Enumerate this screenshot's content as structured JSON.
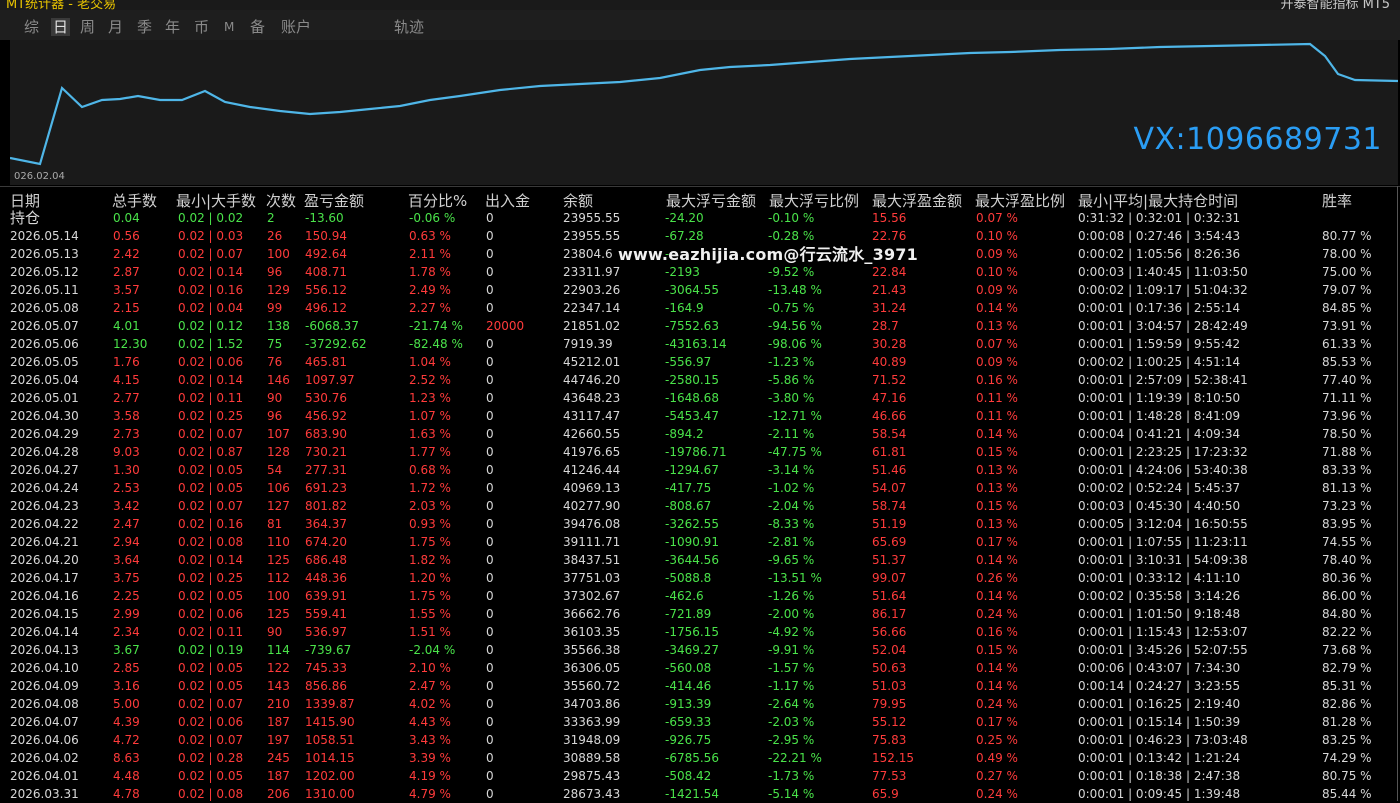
{
  "window": {
    "title_left": "MT统计器 - 老交易",
    "title_right": "开泰智能指标 MT5"
  },
  "tabs": [
    {
      "label": "综",
      "active": false
    },
    {
      "label": "日",
      "active": true
    },
    {
      "label": "周",
      "active": false
    },
    {
      "label": "月",
      "active": false
    },
    {
      "label": "季",
      "active": false
    },
    {
      "label": "年",
      "active": false
    },
    {
      "label": "币",
      "active": false
    },
    {
      "label": "M",
      "active": false
    },
    {
      "label": "备",
      "active": false
    },
    {
      "label": "账户",
      "active": false
    },
    {
      "label": "轨迹",
      "active": false
    }
  ],
  "chart": {
    "start_label": "026.02.04",
    "line_color": "#4fb6e8",
    "watermark": "VX:1096689731"
  },
  "watermark_site": "www.eazhijia.com@行云流水_3971",
  "colors": {
    "up": "#ff3b3b",
    "down": "#4ae34a",
    "neutral": "#d8d8d8",
    "vx": "#2a9df4"
  },
  "table": {
    "headers": {
      "date": "日期",
      "lots": "总手数",
      "range": "最小|大手数",
      "trades": "次数",
      "pnl": "盈亏金额",
      "pct": "百分比%",
      "io": "出入金",
      "bal": "余额",
      "mfl": "最大浮亏金额",
      "mflp": "最大浮亏比例",
      "mfp": "最大浮盈金额",
      "mfpp": "最大浮盈比例",
      "hold": "最小|平均|最大持仓时间",
      "win": "胜率"
    },
    "holding": {
      "label": "持仓",
      "lots": "0.04",
      "range": "0.02 | 0.02",
      "trades": "2",
      "pnl": "-13.60",
      "pct": "-0.06 %",
      "io": "0",
      "bal": "23955.55",
      "mfl": "-24.20",
      "mflp": "-0.10 %",
      "mfp": "15.56",
      "mfpp": "0.07 %",
      "hold": "0:31:32 | 0:32:01 | 0:32:31",
      "win": ""
    },
    "rows": [
      {
        "date": "2026.05.14",
        "lots": "0.56",
        "range": "0.02 | 0.03",
        "trades": "26",
        "pnl": "150.94",
        "pct": "0.63 %",
        "io": "0",
        "bal": "23955.55",
        "mfl": "-67.28",
        "mflp": "-0.28 %",
        "mfp": "22.76",
        "mfpp": "0.10 %",
        "hold": "0:00:08 | 0:27:46 | 3:54:43",
        "win": "80.77 %",
        "up": true
      },
      {
        "date": "2026.05.13",
        "lots": "2.42",
        "range": "0.02 | 0.07",
        "trades": "100",
        "pnl": "492.64",
        "pct": "2.11 %",
        "io": "0",
        "bal": "23804.6",
        "mfl": "-",
        "mflp": "",
        "mfp": "",
        "mfpp": "0.09 %",
        "hold": "0:00:02 | 1:05:56 | 8:26:36",
        "win": "78.00 %",
        "up": true
      },
      {
        "date": "2026.05.12",
        "lots": "2.87",
        "range": "0.02 | 0.14",
        "trades": "96",
        "pnl": "408.71",
        "pct": "1.78 %",
        "io": "0",
        "bal": "23311.97",
        "mfl": "-2193",
        "mflp": "-9.52 %",
        "mfp": "22.84",
        "mfpp": "0.10 %",
        "hold": "0:00:03 | 1:40:45 | 11:03:50",
        "win": "75.00 %",
        "up": true
      },
      {
        "date": "2026.05.11",
        "lots": "3.57",
        "range": "0.02 | 0.16",
        "trades": "129",
        "pnl": "556.12",
        "pct": "2.49 %",
        "io": "0",
        "bal": "22903.26",
        "mfl": "-3064.55",
        "mflp": "-13.48 %",
        "mfp": "21.43",
        "mfpp": "0.09 %",
        "hold": "0:00:02 | 1:09:17 | 51:04:32",
        "win": "79.07 %",
        "up": true
      },
      {
        "date": "2026.05.08",
        "lots": "2.15",
        "range": "0.02 | 0.04",
        "trades": "99",
        "pnl": "496.12",
        "pct": "2.27 %",
        "io": "0",
        "bal": "22347.14",
        "mfl": "-164.9",
        "mflp": "-0.75 %",
        "mfp": "31.24",
        "mfpp": "0.14 %",
        "hold": "0:00:01 | 0:17:36 | 2:55:14",
        "win": "84.85 %",
        "up": true
      },
      {
        "date": "2026.05.07",
        "lots": "4.01",
        "range": "0.02 | 0.12",
        "trades": "138",
        "pnl": "-6068.37",
        "pct": "-21.74 %",
        "io": "20000",
        "bal": "21851.02",
        "mfl": "-7552.63",
        "mflp": "-94.56 %",
        "mfp": "28.7",
        "mfpp": "0.13 %",
        "hold": "0:00:01 | 3:04:57 | 28:42:49",
        "win": "73.91 %",
        "up": false
      },
      {
        "date": "2026.05.06",
        "lots": "12.30",
        "range": "0.02 | 1.52",
        "trades": "75",
        "pnl": "-37292.62",
        "pct": "-82.48 %",
        "io": "0",
        "bal": "7919.39",
        "mfl": "-43163.14",
        "mflp": "-98.06 %",
        "mfp": "30.28",
        "mfpp": "0.07 %",
        "hold": "0:00:01 | 1:59:59 | 9:55:42",
        "win": "61.33 %",
        "up": false
      },
      {
        "date": "2026.05.05",
        "lots": "1.76",
        "range": "0.02 | 0.06",
        "trades": "76",
        "pnl": "465.81",
        "pct": "1.04 %",
        "io": "0",
        "bal": "45212.01",
        "mfl": "-556.97",
        "mflp": "-1.23 %",
        "mfp": "40.89",
        "mfpp": "0.09 %",
        "hold": "0:00:02 | 1:00:25 | 4:51:14",
        "win": "85.53 %",
        "up": true
      },
      {
        "date": "2026.05.04",
        "lots": "4.15",
        "range": "0.02 | 0.14",
        "trades": "146",
        "pnl": "1097.97",
        "pct": "2.52 %",
        "io": "0",
        "bal": "44746.20",
        "mfl": "-2580.15",
        "mflp": "-5.86 %",
        "mfp": "71.52",
        "mfpp": "0.16 %",
        "hold": "0:00:01 | 2:57:09 | 52:38:41",
        "win": "77.40 %",
        "up": true
      },
      {
        "date": "2026.05.01",
        "lots": "2.77",
        "range": "0.02 | 0.11",
        "trades": "90",
        "pnl": "530.76",
        "pct": "1.23 %",
        "io": "0",
        "bal": "43648.23",
        "mfl": "-1648.68",
        "mflp": "-3.80 %",
        "mfp": "47.16",
        "mfpp": "0.11 %",
        "hold": "0:00:01 | 1:19:39 | 8:10:50",
        "win": "71.11 %",
        "up": true
      },
      {
        "date": "2026.04.30",
        "lots": "3.58",
        "range": "0.02 | 0.25",
        "trades": "96",
        "pnl": "456.92",
        "pct": "1.07 %",
        "io": "0",
        "bal": "43117.47",
        "mfl": "-5453.47",
        "mflp": "-12.71 %",
        "mfp": "46.66",
        "mfpp": "0.11 %",
        "hold": "0:00:01 | 1:48:28 | 8:41:09",
        "win": "73.96 %",
        "up": true
      },
      {
        "date": "2026.04.29",
        "lots": "2.73",
        "range": "0.02 | 0.07",
        "trades": "107",
        "pnl": "683.90",
        "pct": "1.63 %",
        "io": "0",
        "bal": "42660.55",
        "mfl": "-894.2",
        "mflp": "-2.11 %",
        "mfp": "58.54",
        "mfpp": "0.14 %",
        "hold": "0:00:04 | 0:41:21 | 4:09:34",
        "win": "78.50 %",
        "up": true
      },
      {
        "date": "2026.04.28",
        "lots": "9.03",
        "range": "0.02 | 0.87",
        "trades": "128",
        "pnl": "730.21",
        "pct": "1.77 %",
        "io": "0",
        "bal": "41976.65",
        "mfl": "-19786.71",
        "mflp": "-47.75 %",
        "mfp": "61.81",
        "mfpp": "0.15 %",
        "hold": "0:00:01 | 2:23:25 | 17:23:32",
        "win": "71.88 %",
        "up": true
      },
      {
        "date": "2026.04.27",
        "lots": "1.30",
        "range": "0.02 | 0.05",
        "trades": "54",
        "pnl": "277.31",
        "pct": "0.68 %",
        "io": "0",
        "bal": "41246.44",
        "mfl": "-1294.67",
        "mflp": "-3.14 %",
        "mfp": "51.46",
        "mfpp": "0.13 %",
        "hold": "0:00:01 | 4:24:06 | 53:40:38",
        "win": "83.33 %",
        "up": true
      },
      {
        "date": "2026.04.24",
        "lots": "2.53",
        "range": "0.02 | 0.05",
        "trades": "106",
        "pnl": "691.23",
        "pct": "1.72 %",
        "io": "0",
        "bal": "40969.13",
        "mfl": "-417.75",
        "mflp": "-1.02 %",
        "mfp": "54.07",
        "mfpp": "0.13 %",
        "hold": "0:00:02 | 0:52:24 | 5:45:37",
        "win": "81.13 %",
        "up": true
      },
      {
        "date": "2026.04.23",
        "lots": "3.42",
        "range": "0.02 | 0.07",
        "trades": "127",
        "pnl": "801.82",
        "pct": "2.03 %",
        "io": "0",
        "bal": "40277.90",
        "mfl": "-808.67",
        "mflp": "-2.04 %",
        "mfp": "58.74",
        "mfpp": "0.15 %",
        "hold": "0:00:03 | 0:45:30 | 4:40:50",
        "win": "73.23 %",
        "up": true
      },
      {
        "date": "2026.04.22",
        "lots": "2.47",
        "range": "0.02 | 0.16",
        "trades": "81",
        "pnl": "364.37",
        "pct": "0.93 %",
        "io": "0",
        "bal": "39476.08",
        "mfl": "-3262.55",
        "mflp": "-8.33 %",
        "mfp": "51.19",
        "mfpp": "0.13 %",
        "hold": "0:00:05 | 3:12:04 | 16:50:55",
        "win": "83.95 %",
        "up": true
      },
      {
        "date": "2026.04.21",
        "lots": "2.94",
        "range": "0.02 | 0.08",
        "trades": "110",
        "pnl": "674.20",
        "pct": "1.75 %",
        "io": "0",
        "bal": "39111.71",
        "mfl": "-1090.91",
        "mflp": "-2.81 %",
        "mfp": "65.69",
        "mfpp": "0.17 %",
        "hold": "0:00:01 | 1:07:55 | 11:23:11",
        "win": "74.55 %",
        "up": true
      },
      {
        "date": "2026.04.20",
        "lots": "3.64",
        "range": "0.02 | 0.14",
        "trades": "125",
        "pnl": "686.48",
        "pct": "1.82 %",
        "io": "0",
        "bal": "38437.51",
        "mfl": "-3644.56",
        "mflp": "-9.65 %",
        "mfp": "51.37",
        "mfpp": "0.14 %",
        "hold": "0:00:01 | 3:10:31 | 54:09:38",
        "win": "78.40 %",
        "up": true
      },
      {
        "date": "2026.04.17",
        "lots": "3.75",
        "range": "0.02 | 0.25",
        "trades": "112",
        "pnl": "448.36",
        "pct": "1.20 %",
        "io": "0",
        "bal": "37751.03",
        "mfl": "-5088.8",
        "mflp": "-13.51 %",
        "mfp": "99.07",
        "mfpp": "0.26 %",
        "hold": "0:00:01 | 0:33:12 | 4:11:10",
        "win": "80.36 %",
        "up": true
      },
      {
        "date": "2026.04.16",
        "lots": "2.25",
        "range": "0.02 | 0.05",
        "trades": "100",
        "pnl": "639.91",
        "pct": "1.75 %",
        "io": "0",
        "bal": "37302.67",
        "mfl": "-462.6",
        "mflp": "-1.26 %",
        "mfp": "51.64",
        "mfpp": "0.14 %",
        "hold": "0:00:02 | 0:35:58 | 3:14:26",
        "win": "86.00 %",
        "up": true
      },
      {
        "date": "2026.04.15",
        "lots": "2.99",
        "range": "0.02 | 0.06",
        "trades": "125",
        "pnl": "559.41",
        "pct": "1.55 %",
        "io": "0",
        "bal": "36662.76",
        "mfl": "-721.89",
        "mflp": "-2.00 %",
        "mfp": "86.17",
        "mfpp": "0.24 %",
        "hold": "0:00:01 | 1:01:50 | 9:18:48",
        "win": "84.80 %",
        "up": true
      },
      {
        "date": "2026.04.14",
        "lots": "2.34",
        "range": "0.02 | 0.11",
        "trades": "90",
        "pnl": "536.97",
        "pct": "1.51 %",
        "io": "0",
        "bal": "36103.35",
        "mfl": "-1756.15",
        "mflp": "-4.92 %",
        "mfp": "56.66",
        "mfpp": "0.16 %",
        "hold": "0:00:01 | 1:15:43 | 12:53:07",
        "win": "82.22 %",
        "up": true
      },
      {
        "date": "2026.04.13",
        "lots": "3.67",
        "range": "0.02 | 0.19",
        "trades": "114",
        "pnl": "-739.67",
        "pct": "-2.04 %",
        "io": "0",
        "bal": "35566.38",
        "mfl": "-3469.27",
        "mflp": "-9.91 %",
        "mfp": "52.04",
        "mfpp": "0.15 %",
        "hold": "0:00:01 | 3:45:26 | 52:07:55",
        "win": "73.68 %",
        "up": false
      },
      {
        "date": "2026.04.10",
        "lots": "2.85",
        "range": "0.02 | 0.05",
        "trades": "122",
        "pnl": "745.33",
        "pct": "2.10 %",
        "io": "0",
        "bal": "36306.05",
        "mfl": "-560.08",
        "mflp": "-1.57 %",
        "mfp": "50.63",
        "mfpp": "0.14 %",
        "hold": "0:00:06 | 0:43:07 | 7:34:30",
        "win": "82.79 %",
        "up": true
      },
      {
        "date": "2026.04.09",
        "lots": "3.16",
        "range": "0.02 | 0.05",
        "trades": "143",
        "pnl": "856.86",
        "pct": "2.47 %",
        "io": "0",
        "bal": "35560.72",
        "mfl": "-414.46",
        "mflp": "-1.17 %",
        "mfp": "51.03",
        "mfpp": "0.14 %",
        "hold": "0:00:14 | 0:24:27 | 3:23:55",
        "win": "85.31 %",
        "up": true
      },
      {
        "date": "2026.04.08",
        "lots": "5.00",
        "range": "0.02 | 0.07",
        "trades": "210",
        "pnl": "1339.87",
        "pct": "4.02 %",
        "io": "0",
        "bal": "34703.86",
        "mfl": "-913.39",
        "mflp": "-2.64 %",
        "mfp": "79.95",
        "mfpp": "0.24 %",
        "hold": "0:00:01 | 0:16:25 | 2:19:40",
        "win": "82.86 %",
        "up": true
      },
      {
        "date": "2026.04.07",
        "lots": "4.39",
        "range": "0.02 | 0.06",
        "trades": "187",
        "pnl": "1415.90",
        "pct": "4.43 %",
        "io": "0",
        "bal": "33363.99",
        "mfl": "-659.33",
        "mflp": "-2.03 %",
        "mfp": "55.12",
        "mfpp": "0.17 %",
        "hold": "0:00:01 | 0:15:14 | 1:50:39",
        "win": "81.28 %",
        "up": true
      },
      {
        "date": "2026.04.06",
        "lots": "4.72",
        "range": "0.02 | 0.07",
        "trades": "197",
        "pnl": "1058.51",
        "pct": "3.43 %",
        "io": "0",
        "bal": "31948.09",
        "mfl": "-926.75",
        "mflp": "-2.95 %",
        "mfp": "75.83",
        "mfpp": "0.25 %",
        "hold": "0:00:01 | 0:46:23 | 73:03:48",
        "win": "83.25 %",
        "up": true
      },
      {
        "date": "2026.04.02",
        "lots": "8.63",
        "range": "0.02 | 0.28",
        "trades": "245",
        "pnl": "1014.15",
        "pct": "3.39 %",
        "io": "0",
        "bal": "30889.58",
        "mfl": "-6785.56",
        "mflp": "-22.21 %",
        "mfp": "152.15",
        "mfpp": "0.49 %",
        "hold": "0:00:01 | 0:13:42 | 1:21:24",
        "win": "74.29 %",
        "up": true
      },
      {
        "date": "2026.04.01",
        "lots": "4.48",
        "range": "0.02 | 0.05",
        "trades": "187",
        "pnl": "1202.00",
        "pct": "4.19 %",
        "io": "0",
        "bal": "29875.43",
        "mfl": "-508.42",
        "mflp": "-1.73 %",
        "mfp": "77.53",
        "mfpp": "0.27 %",
        "hold": "0:00:01 | 0:18:38 | 2:47:38",
        "win": "80.75 %",
        "up": true
      },
      {
        "date": "2026.03.31",
        "lots": "4.78",
        "range": "0.02 | 0.08",
        "trades": "206",
        "pnl": "1310.00",
        "pct": "4.79 %",
        "io": "0",
        "bal": "28673.43",
        "mfl": "-1421.54",
        "mflp": "-5.14 %",
        "mfp": "65.9",
        "mfpp": "0.24 %",
        "hold": "0:00:01 | 0:09:45 | 1:39:48",
        "win": "85.44 %",
        "up": true
      }
    ]
  }
}
